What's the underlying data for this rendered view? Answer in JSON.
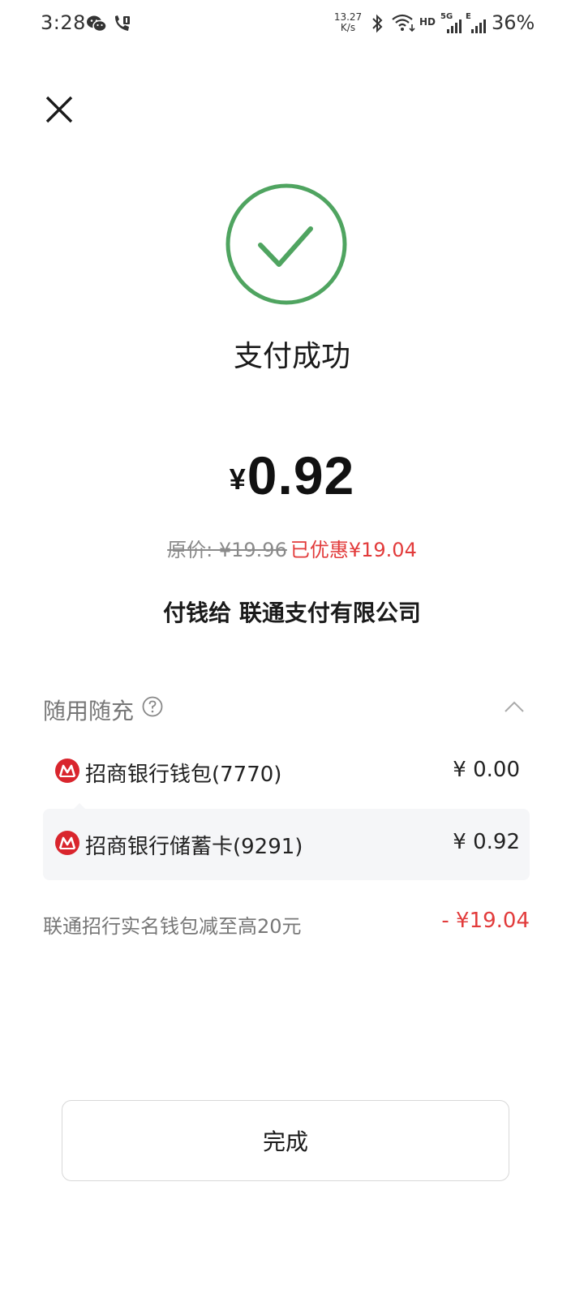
{
  "status_bar": {
    "time": "3:28",
    "net_speed_value": "13.27",
    "net_speed_unit": "K/s",
    "hd_label": "HD",
    "sim1_label": "5G",
    "sim2_label": "E",
    "battery": "36%"
  },
  "result": {
    "title": "支付成功",
    "currency": "¥",
    "amount": "0.92",
    "original_price": "原价: ¥19.96",
    "discount_text": "已优惠¥19.04",
    "payee": "付钱给 联通支付有限公司"
  },
  "payment_section": {
    "title": "随用随充",
    "rows": [
      {
        "label": "招商银行钱包(7770)",
        "amount": "¥ 0.00"
      },
      {
        "label": "招商银行储蓄卡(9291)",
        "amount": "¥ 0.92"
      }
    ],
    "promo_label": "联通招行实名钱包减至高20元",
    "promo_amount": "- ¥19.04"
  },
  "actions": {
    "done_label": "完成"
  },
  "colors": {
    "success_green": "#4fa460",
    "discount_red": "#e23b3b",
    "bank_red": "#d9252d"
  }
}
